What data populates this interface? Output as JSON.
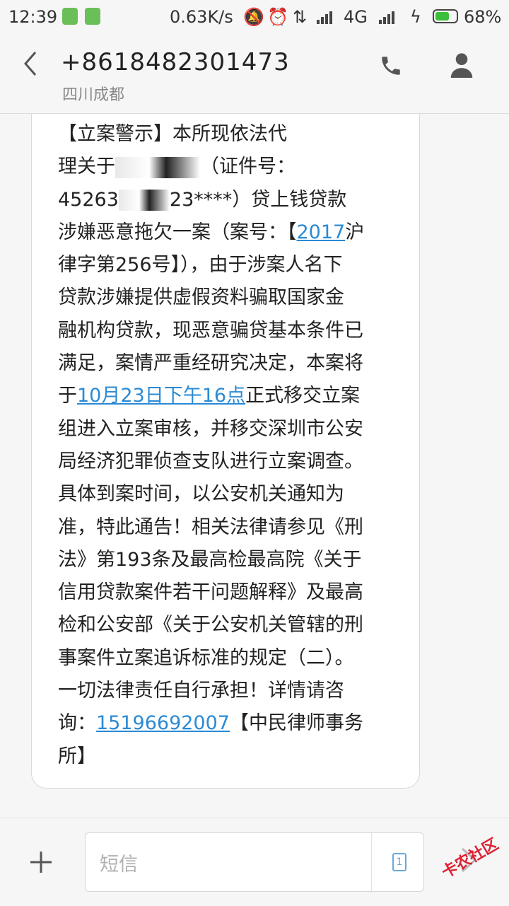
{
  "status_bar": {
    "time": "12:39",
    "net_speed": "0.63K/s",
    "network": "4G",
    "battery_pct": "68%",
    "battery_level": 0.68,
    "icons": [
      "sim-app-icon",
      "android-icon",
      "mute-icon",
      "alarm-icon",
      "data-arrows-icon",
      "signal-icon",
      "signal-icon",
      "charging-icon"
    ]
  },
  "header": {
    "contact_number": "+8618482301473",
    "location": "四川成都",
    "back_icon": "chevron-left-icon",
    "phone_icon": "phone-icon",
    "contact_icon": "person-icon"
  },
  "message": {
    "l1": "【立案警示】本所现依法代",
    "l2a": "理关于",
    "l2b": "（证件号：",
    "l3a": "45263",
    "l3b": "23****）贷上钱贷款",
    "l4a": "涉嫌恶意拖欠一案（案号：【",
    "l4link": "2017",
    "l4b": "沪",
    "l5": "律字第256号】），由于涉案人名下",
    "l6": "贷款涉嫌提供虚假资料骗取国家金",
    "l7": "融机构贷款，现恶意骗贷基本条件已",
    "l8": "满足，案情严重经研究决定，本案将",
    "l9a": "于",
    "l9link": "10月23日下午16点",
    "l9b": "正式移交立案",
    "l10": "组进入立案审核，并移交深圳市公安",
    "l11": "局经济犯罪侦查支队进行立案调查。",
    "l12": "具体到案时间，以公安机关通知为",
    "l13": "准，特此通告！相关法律请参见《刑",
    "l14": "法》第193条及最高检最高院《关于",
    "l15": "信用贷款案件若干问题解释》及最高",
    "l16": "检和公安部《关于公安机关管辖的刑",
    "l17": "事案件立案追诉标准的规定（二）。",
    "l18": "一切法律责任自行承担！详情请咨",
    "l19a": "询：",
    "l19link": "15196692007",
    "l19b": "【中民律师事务",
    "l20": "所】"
  },
  "input": {
    "placeholder": "短信",
    "sim_label": "1",
    "watermark": "卡农社区"
  },
  "colors": {
    "link": "#2a8ad4",
    "background": "#f6f6f6",
    "bubble": "#ffffff"
  }
}
